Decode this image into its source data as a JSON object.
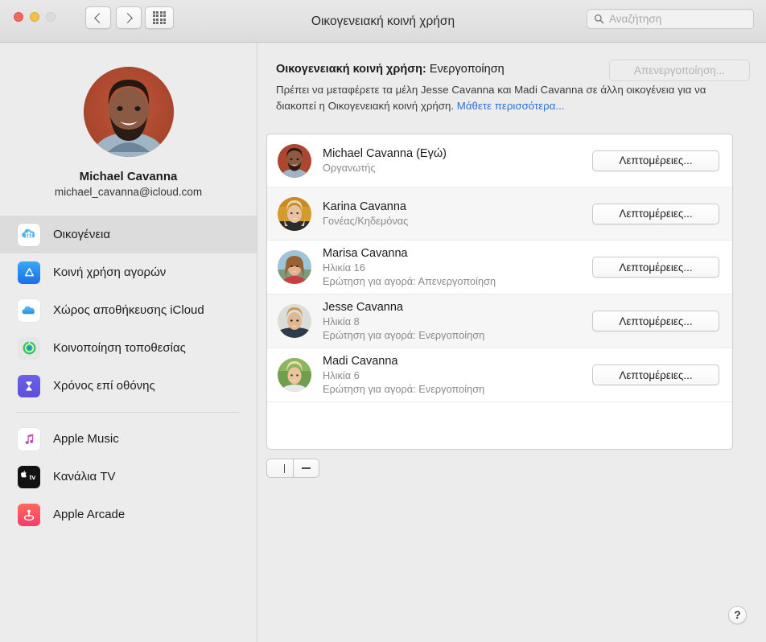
{
  "window": {
    "title": "Οικογενειακή κοινή χρήση",
    "traffic_lights": [
      "close",
      "minimize",
      "zoom-disabled"
    ]
  },
  "toolbar": {
    "back_icon": "chevron-left-icon",
    "forward_icon": "chevron-right-icon",
    "grid_icon": "grid-icon",
    "search": {
      "placeholder": "Αναζήτηση",
      "value": "",
      "icon": "search-icon"
    }
  },
  "sidebar": {
    "profile": {
      "name": "Michael Cavanna",
      "email": "michael_cavanna@icloud.com",
      "avatar": "user-avatar"
    },
    "items": [
      {
        "label": "Οικογένεια",
        "icon": "family-sharing-icon",
        "selected": true
      },
      {
        "label": "Κοινή χρήση αγορών",
        "icon": "app-store-icon",
        "selected": false
      },
      {
        "label": "Χώρος αποθήκευσης iCloud",
        "icon": "icloud-icon",
        "selected": false
      },
      {
        "label": "Κοινοποίηση τοποθεσίας",
        "icon": "find-my-icon",
        "selected": false
      },
      {
        "label": "Χρόνος επί οθόνης",
        "icon": "screen-time-icon",
        "selected": false
      }
    ],
    "items_secondary": [
      {
        "label": "Apple Music",
        "icon": "apple-music-icon",
        "selected": false
      },
      {
        "label": "Κανάλια TV",
        "icon": "apple-tv-icon",
        "selected": false
      },
      {
        "label": "Apple Arcade",
        "icon": "apple-arcade-icon",
        "selected": false
      }
    ]
  },
  "main": {
    "status_label": "Οικογενειακή κοινή χρήση:",
    "status_value": "Ενεργοποίηση",
    "turn_off_button": "Απενεργοποίηση...",
    "turn_off_disabled": true,
    "description": "Πρέπει να μεταφέρετε τα μέλη Jesse Cavanna και Madi Cavanna σε άλλη οικογένεια για να διακοπεί η Οικογενειακή κοινή χρήση.",
    "learn_more": "Μάθετε περισσότερα...",
    "details_button": "Λεπτομέρειες...",
    "add_button_icon": "plus-icon",
    "remove_button_icon": "minus-icon",
    "help_button": "?",
    "members": [
      {
        "name": "Michael Cavanna (Εγώ)",
        "role": "Οργανωτής",
        "purchase_line": "",
        "avatar": "avatar-michael"
      },
      {
        "name": "Karina Cavanna",
        "role": "Γονέας/Κηδεμόνας",
        "purchase_line": "",
        "avatar": "avatar-karina"
      },
      {
        "name": "Marisa Cavanna",
        "role": "Ηλικία 16",
        "purchase_line": "Ερώτηση για αγορά: Απενεργοποίηση",
        "avatar": "avatar-marisa"
      },
      {
        "name": "Jesse Cavanna",
        "role": "Ηλικία 8",
        "purchase_line": "Ερώτηση για αγορά: Ενεργοποίηση",
        "avatar": "avatar-jesse"
      },
      {
        "name": "Madi Cavanna",
        "role": "Ηλικία 6",
        "purchase_line": "Ερώτηση για αγορά: Ενεργοποίηση",
        "avatar": "avatar-madi"
      }
    ]
  },
  "colors": {
    "accent_link": "#2b72d7",
    "sidebar_bg": "#ececec",
    "selected_row": "#dcdcdc",
    "window_bg": "#ececec"
  }
}
